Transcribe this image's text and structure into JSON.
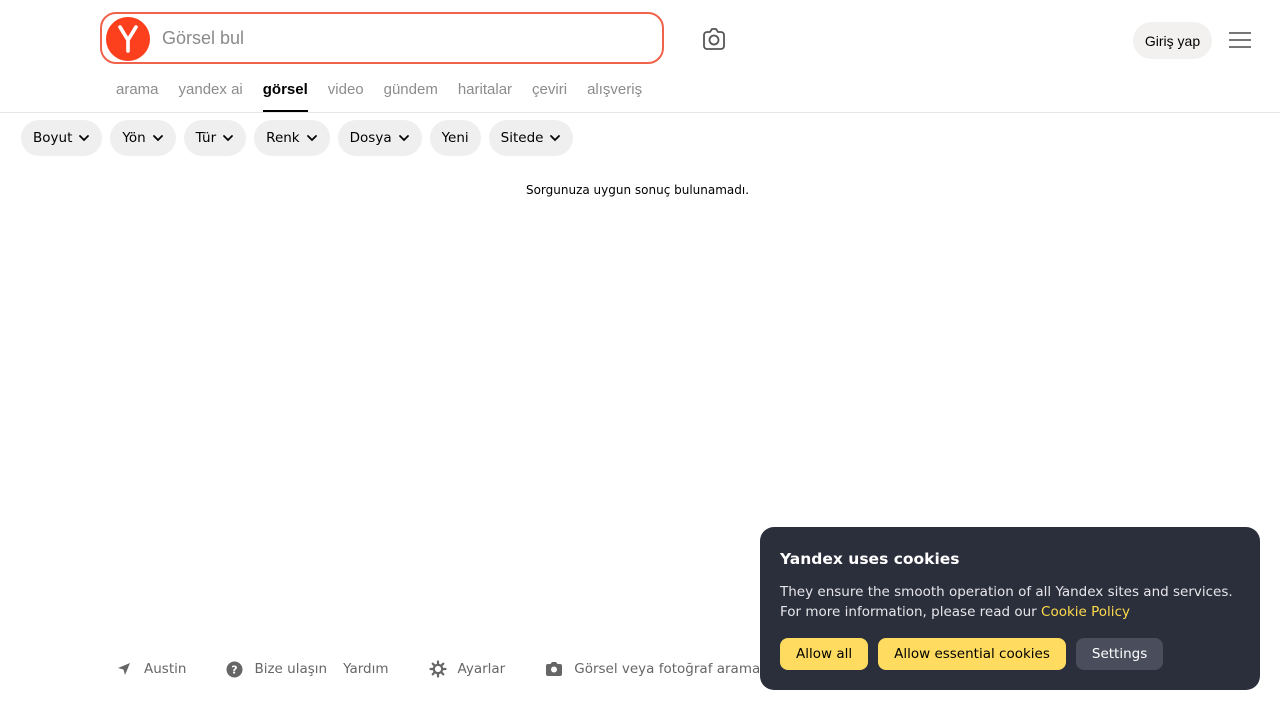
{
  "search": {
    "placeholder": "Görsel bul",
    "value": ""
  },
  "header": {
    "login_label": "Giriş yap"
  },
  "tabs": [
    {
      "label": "arama"
    },
    {
      "label": "yandex ai"
    },
    {
      "label": "görsel",
      "active": true
    },
    {
      "label": "video"
    },
    {
      "label": "gündem"
    },
    {
      "label": "haritalar"
    },
    {
      "label": "çeviri"
    },
    {
      "label": "alışveriş"
    }
  ],
  "filters": [
    {
      "label": "Boyut",
      "dropdown": true
    },
    {
      "label": "Yön",
      "dropdown": true
    },
    {
      "label": "Tür",
      "dropdown": true
    },
    {
      "label": "Renk",
      "dropdown": true
    },
    {
      "label": "Dosya",
      "dropdown": true
    },
    {
      "label": "Yeni",
      "dropdown": false
    },
    {
      "label": "Sitede",
      "dropdown": true
    }
  ],
  "results": {
    "empty_message": "Sorgunuza uygun sonuç bulunamadı."
  },
  "footer": {
    "location": "Austin",
    "contact": "Bize ulaşın",
    "help": "Yardım",
    "settings": "Ayarlar",
    "image_search": "Görsel veya fotoğraf arama"
  },
  "cookie": {
    "title": "Yandex uses cookies",
    "text": "They ensure the smooth operation of all Yandex sites and services. For more information, please read our",
    "link": "Cookie Policy",
    "allow_all": "Allow all",
    "allow_essential": "Allow essential cookies",
    "settings": "Settings"
  },
  "colors": {
    "accent": "#fc3f1d",
    "search_border": "#f0624a",
    "cookie_bg": "#2b2e3b",
    "cookie_button": "#ffdc60",
    "cookie_link": "#ffdb4d"
  },
  "icons": {
    "logo": "yandex-logo-icon",
    "camera": "camera-search-icon",
    "menu": "hamburger-menu-icon",
    "chevron": "chevron-down-icon",
    "location": "location-arrow-icon",
    "help": "question-circle-icon",
    "settings": "gear-icon",
    "image_search": "camera-icon"
  }
}
